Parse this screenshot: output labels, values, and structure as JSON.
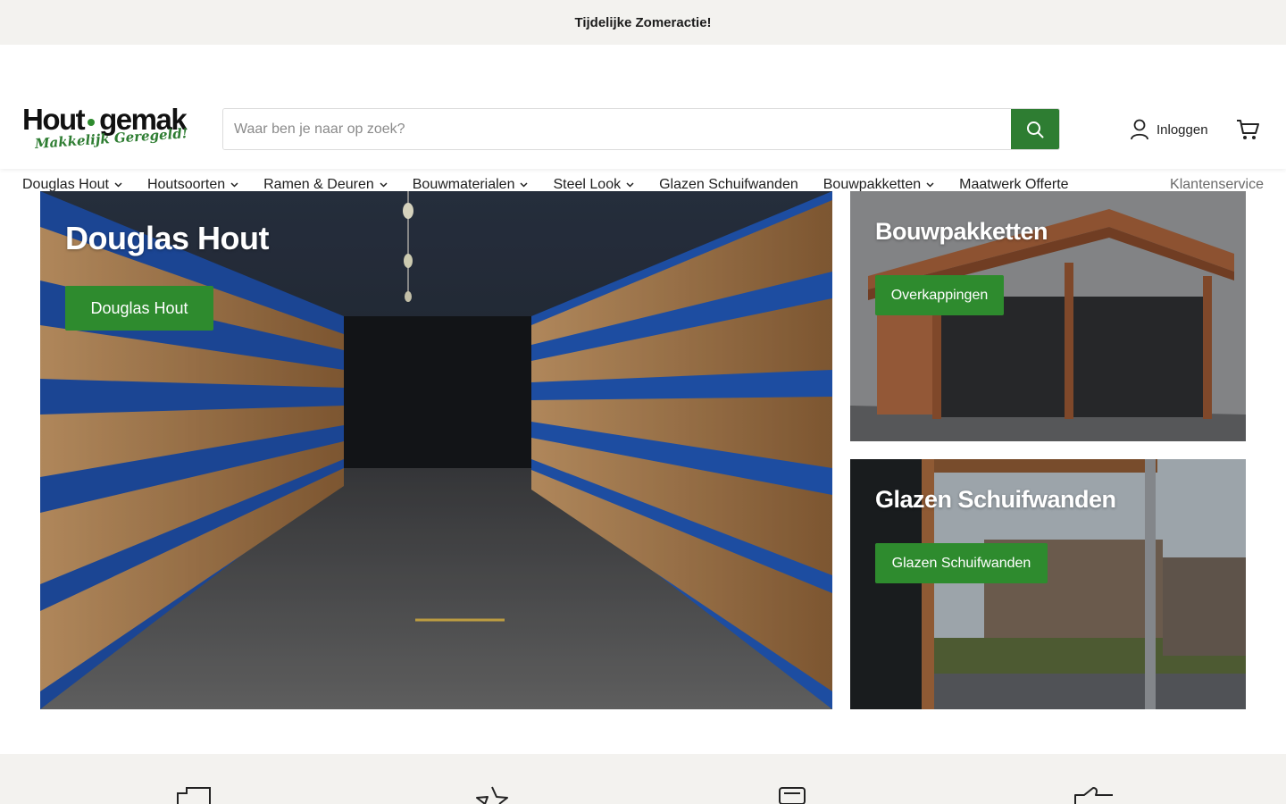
{
  "announcement": "Tijdelijke Zomeractie!",
  "logo": {
    "main_left": "Hout",
    "main_right": "gemak",
    "tagline": "Makkelijk Geregeld!"
  },
  "search": {
    "placeholder": "Waar ben je naar op zoek?",
    "icon": "search-icon"
  },
  "account": {
    "login_label": "Inloggen",
    "icon": "user-icon",
    "cart_icon": "cart-icon"
  },
  "nav": {
    "items": [
      {
        "label": "Douglas Hout",
        "dropdown": true
      },
      {
        "label": "Houtsoorten",
        "dropdown": true
      },
      {
        "label": "Ramen & Deuren",
        "dropdown": true
      },
      {
        "label": "Bouwmaterialen",
        "dropdown": true
      },
      {
        "label": "Steel Look",
        "dropdown": true
      },
      {
        "label": "Glazen Schuifwanden",
        "dropdown": false
      },
      {
        "label": "Bouwpakketten",
        "dropdown": true
      },
      {
        "label": "Maatwerk Offerte",
        "dropdown": false
      }
    ],
    "right_link": "Klantenservice"
  },
  "promos": {
    "main": {
      "title": "Douglas Hout",
      "button": "Douglas Hout"
    },
    "top": {
      "title": "Bouwpakketten",
      "button": "Overkappingen"
    },
    "bottom": {
      "title": "Glazen Schuifwanden",
      "button": "Glazen Schuifwanden"
    }
  },
  "colors": {
    "brand_green": "#2e7d32",
    "button_green": "#2e8b2e",
    "announce_bg": "#f3f2ef"
  }
}
